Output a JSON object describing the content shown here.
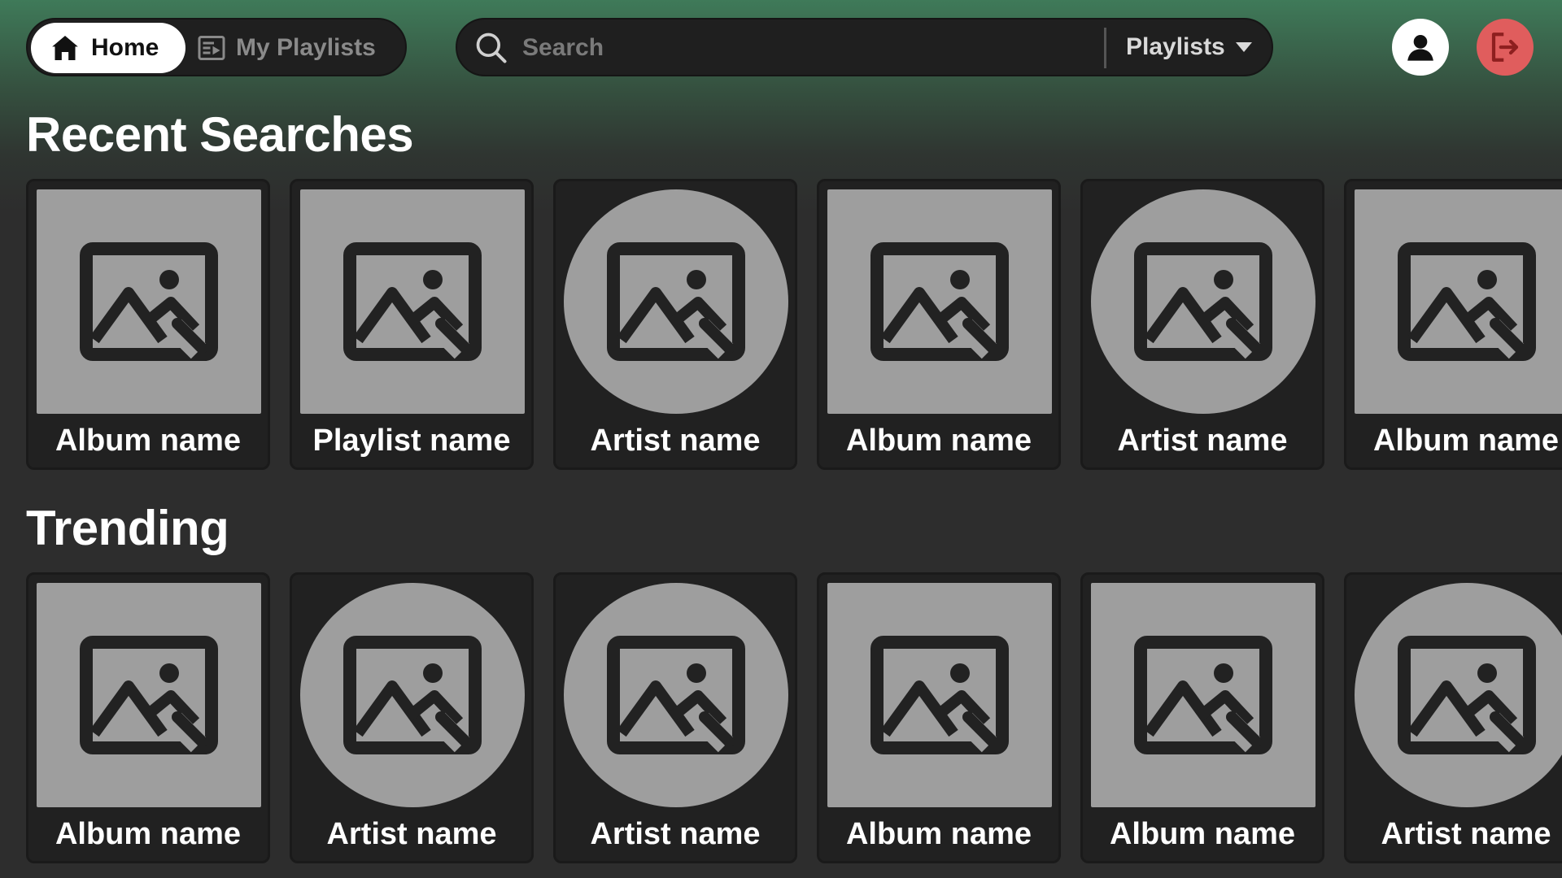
{
  "nav": {
    "home_label": "Home",
    "playlists_label": "My Playlists"
  },
  "search": {
    "placeholder": "Search",
    "value": "",
    "filter_label": "Playlists"
  },
  "colors": {
    "accent_green": "#3f7a59",
    "logout_red": "#e05d5d",
    "card_bg": "#212121",
    "art_placeholder": "#9e9e9e"
  },
  "sections": {
    "recent": {
      "title": "Recent Searches",
      "items": [
        {
          "name": "Album name",
          "kind": "album"
        },
        {
          "name": "Playlist name",
          "kind": "playlist"
        },
        {
          "name": "Artist name",
          "kind": "artist"
        },
        {
          "name": "Album name",
          "kind": "album"
        },
        {
          "name": "Artist name",
          "kind": "artist"
        },
        {
          "name": "Album name",
          "kind": "album"
        }
      ]
    },
    "trending": {
      "title": "Trending",
      "items": [
        {
          "name": "Album name",
          "kind": "album"
        },
        {
          "name": "Artist name",
          "kind": "artist"
        },
        {
          "name": "Artist name",
          "kind": "artist"
        },
        {
          "name": "Album name",
          "kind": "album"
        },
        {
          "name": "Album name",
          "kind": "album"
        },
        {
          "name": "Artist name",
          "kind": "artist"
        }
      ]
    }
  }
}
